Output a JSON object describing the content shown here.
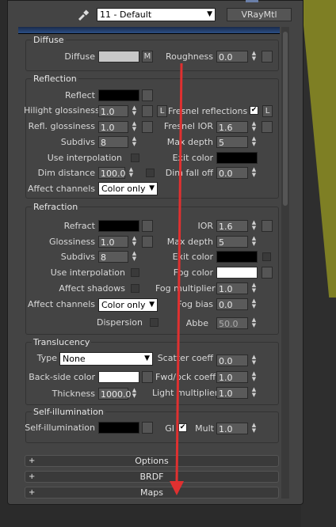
{
  "material": {
    "name": "11 - Default",
    "type_button": "VRayMtl",
    "colors": {
      "panel": "#444444",
      "accent_red": "#e03030",
      "olive": "#7e7f24"
    }
  },
  "diffuse": {
    "title": "Diffuse",
    "diffuse_label": "Diffuse",
    "m_button": "M",
    "roughness_label": "Roughness",
    "roughness_value": "0.0"
  },
  "reflection": {
    "title": "Reflection",
    "reflect_label": "Reflect",
    "hilight_label": "Hilight glossiness",
    "hilight_value": "1.0",
    "l_button": "L",
    "fresnel_label": "Fresnel reflections",
    "fresnel_checked": "✔",
    "refl_gloss_label": "Refl. glossiness",
    "refl_gloss_value": "1.0",
    "fresnel_ior_label": "Fresnel IOR",
    "fresnel_ior_value": "1.6",
    "subdivs_label": "Subdivs",
    "subdivs_value": "8",
    "max_depth_label": "Max depth",
    "max_depth_value": "5",
    "use_interp_label": "Use interpolation",
    "exit_color_label": "Exit color",
    "dim_distance_label": "Dim distance",
    "dim_distance_value": "100.0",
    "dim_falloff_label": "Dim fall off",
    "dim_falloff_value": "0.0",
    "affect_channels_label": "Affect channels",
    "affect_channels_value": "Color only"
  },
  "refraction": {
    "title": "Refraction",
    "refract_label": "Refract",
    "ior_label": "IOR",
    "ior_value": "1.6",
    "glossiness_label": "Glossiness",
    "glossiness_value": "1.0",
    "max_depth_label": "Max depth",
    "max_depth_value": "5",
    "subdivs_label": "Subdivs",
    "subdivs_value": "8",
    "exit_color_label": "Exit color",
    "use_interp_label": "Use interpolation",
    "fog_color_label": "Fog color",
    "affect_shadows_label": "Affect shadows",
    "fog_mult_label": "Fog multiplier",
    "fog_mult_value": "1.0",
    "affect_channels_label": "Affect channels",
    "affect_channels_value": "Color only",
    "fog_bias_label": "Fog bias",
    "fog_bias_value": "0.0",
    "dispersion_label": "Dispersion",
    "abbe_label": "Abbe",
    "abbe_value": "50.0"
  },
  "translucency": {
    "title": "Translucency",
    "type_label": "Type",
    "type_value": "None",
    "scatter_label": "Scatter coeff",
    "scatter_value": "0.0",
    "backside_label": "Back-side color",
    "fwd_back_label": "Fwd/bck coeff",
    "fwd_back_value": "1.0",
    "thickness_label": "Thickness",
    "thickness_value": "1000.0",
    "light_mult_label": "Light multiplier",
    "light_mult_value": "1.0"
  },
  "self_illumination": {
    "title": "Self-illumination",
    "label": "Self-illumination",
    "gi_label": "GI",
    "gi_checked": "✔",
    "mult_label": "Mult",
    "mult_value": "1.0"
  },
  "rollouts": [
    {
      "plus": "+",
      "label": "Options"
    },
    {
      "plus": "+",
      "label": "BRDF"
    },
    {
      "plus": "+",
      "label": "Maps"
    }
  ]
}
